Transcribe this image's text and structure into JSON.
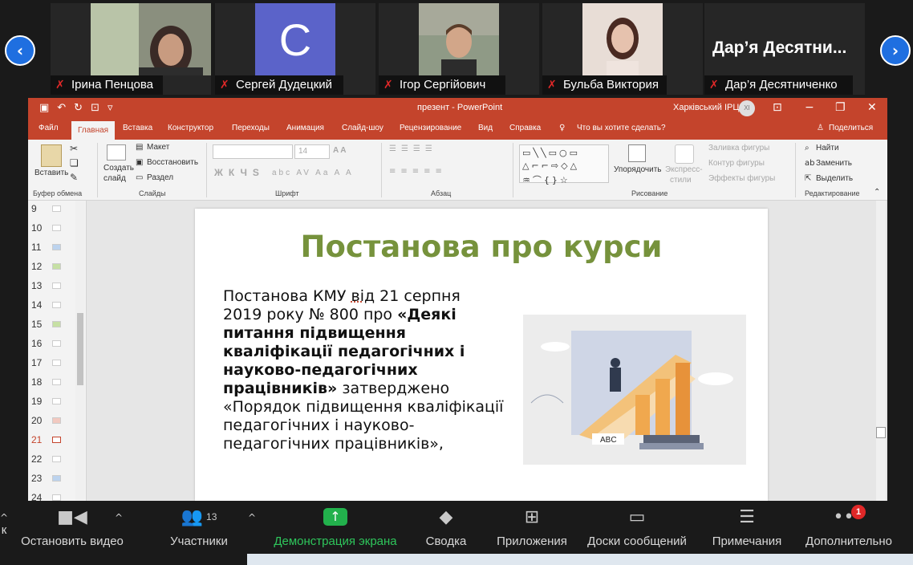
{
  "participants": [
    {
      "name": "Ірина Пенцова",
      "type": "video"
    },
    {
      "name": "Сергей Дудецкий",
      "type": "avatar",
      "initial": "С"
    },
    {
      "name": "Ігор Сергійович",
      "type": "video"
    },
    {
      "name": "Бульба Виктория",
      "type": "video"
    },
    {
      "name": "Дар’я Десятниченко",
      "type": "name",
      "display": "Дар’я  Десятни..."
    }
  ],
  "nav": {
    "prev": "‹",
    "next": "›"
  },
  "ppt": {
    "window_title": "презент  -  PowerPoint",
    "user": "Харківський ІРЦ",
    "user_initials": "XI",
    "tabs": [
      "Файл",
      "Главная",
      "Вставка",
      "Конструктор",
      "Переходы",
      "Анимация",
      "Слайд-шоу",
      "Рецензирование",
      "Вид",
      "Справка"
    ],
    "tell_me": "Что вы хотите сделать?",
    "share": "Поделиться",
    "ribbon": {
      "paste": "Вставить",
      "clipboard": "Буфер обмена",
      "new_slide": "Создать",
      "new_slide2": "слайд",
      "layout": "Макет",
      "reset": "Восстановить",
      "section": "Раздел",
      "slides": "Слайды",
      "font_size": "14",
      "font": "Шрифт",
      "paragraph": "Абзац",
      "arrange": "Упорядочить",
      "styles": "Экспресс-",
      "styles2": "стили",
      "fill": "Заливка фигуры",
      "outline": "Контур фигуры",
      "effects": "Эффекты фигуры",
      "drawing": "Рисование",
      "find": "Найти",
      "replace": "Заменить",
      "select": "Выделить",
      "editing": "Редактирование"
    },
    "thumbnails": [
      "9",
      "10",
      "11",
      "12",
      "13",
      "14",
      "15",
      "16",
      "17",
      "18",
      "19",
      "20",
      "21",
      "22",
      "23",
      "24"
    ],
    "active_thumb": "21",
    "slide": {
      "title": "Постанова про курси",
      "body_1": "Постанова КМУ ",
      "body_2": "від",
      "body_3": " 21 серпня 2019 року № 800 про ",
      "body_bold": "«Деякі питання підвищення кваліфікації педагогічних і науково-педагогічних працівників»",
      "body_4": " затверджено «Порядок підвищення кваліфікації педагогічних і науково-педагогічних працівників»,"
    }
  },
  "toolbar": {
    "stop_video": "Остановить видео",
    "participants": "Участники",
    "participants_count": "13",
    "share": "Демонстрация экрана",
    "summary": "Сводка",
    "apps": "Приложения",
    "boards": "Доски сообщений",
    "notes": "Примечания",
    "more": "Дополнительно",
    "more_badge": "1",
    "left_cut": "к"
  },
  "colors": {
    "accent_ppt": "#c4442c",
    "title_green": "#76923c",
    "zoom_green": "#22b14c",
    "zoom_blue": "#1f6fe0"
  }
}
